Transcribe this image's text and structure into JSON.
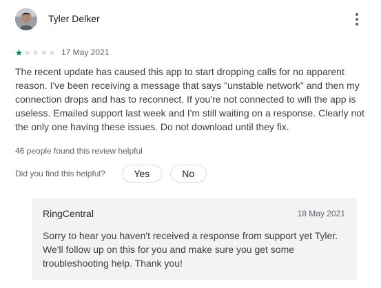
{
  "review": {
    "author": "Tyler Delker",
    "rating": 1,
    "max_rating": 5,
    "date": "17 May 2021",
    "text": "The recent update has caused this app to start dropping calls for no apparent reason. I've been receiving a message that says \"unstable network\" and then my connection drops and has to reconnect. If you're not connected to wifi the app is useless. Emailed support last week and I'm still waiting on a response. Clearly not the only one having these issues. Do not download until they fix.",
    "helpful_count_text": "46 people found this review helpful",
    "helpful_question": "Did you find this helpful?",
    "yes_label": "Yes",
    "no_label": "No"
  },
  "developer_reply": {
    "name": "RingCentral",
    "date": "18 May 2021",
    "text": "Sorry to hear you haven't received a response from support yet Tyler. We'll follow up on this for you and make sure you get some troubleshooting help. Thank you!"
  },
  "colors": {
    "star_filled": "#01875f",
    "star_empty": "#dadce0",
    "reply_background": "#f1f3f4"
  },
  "icons": {
    "menu": "more-vert-icon",
    "star": "star-icon"
  }
}
